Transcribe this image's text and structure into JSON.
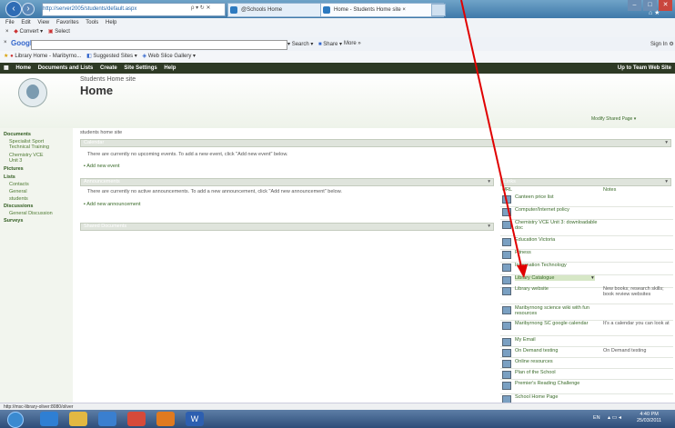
{
  "browser": {
    "address": "http://server2005/students/default.aspx",
    "tabs": [
      "@Schools Home",
      "Home - Students Home site"
    ],
    "menu": [
      "File",
      "Edit",
      "View",
      "Favorites",
      "Tools",
      "Help"
    ],
    "convert_label": "Convert",
    "select_label": "Select",
    "google_label": "Google",
    "google_search": "Search",
    "share_label": "Share",
    "more_label": "More »",
    "signin": "Sign In",
    "fav": [
      "Library Home - Maribyrno...",
      "Suggested Sites",
      "Web Slice Gallery"
    ],
    "status_url": "http://msc-library-oliver:8080/oliver"
  },
  "sharepoint": {
    "topnav": [
      "Home",
      "Documents and Lists",
      "Create",
      "Site Settings",
      "Help"
    ],
    "up_to": "Up to Team Web Site",
    "site_name": "Students Home site",
    "page_title": "Home",
    "modify": "Modify Shared Page ▾",
    "description": "students home site",
    "left_nav": [
      {
        "label": "Documents",
        "head": true
      },
      {
        "label": "Specialist Sport",
        "head": false
      },
      {
        "label": "Technical Training",
        "head": false
      },
      {
        "label": "Chemistry VCE",
        "head": false
      },
      {
        "label": "Unit 3",
        "head": false
      },
      {
        "label": "Pictures",
        "head": true
      },
      {
        "label": "Lists",
        "head": true
      },
      {
        "label": "Contacts",
        "head": false
      },
      {
        "label": "General",
        "head": false
      },
      {
        "label": "students",
        "head": false
      },
      {
        "label": "Discussions",
        "head": true
      },
      {
        "label": "General Discussion",
        "head": false
      },
      {
        "label": "Surveys",
        "head": true
      }
    ],
    "events": {
      "title": "Calendar",
      "text": "There are currently no upcoming events. To add a new event, click \"Add new event\" below.",
      "add": "Add new event"
    },
    "announcements": {
      "title": "Announcements",
      "text": "There are currently no active announcements. To add a new announcement, click \"Add new announcement\" below.",
      "add": "Add new announcement"
    },
    "shared_docs_title": "Shared Documents",
    "links": {
      "title": "Links",
      "col_url": "URL",
      "col_notes": "Notes",
      "rows": [
        {
          "url": "Canteen price list",
          "notes": ""
        },
        {
          "url": "Computer/Internet policy",
          "notes": ""
        },
        {
          "url": "Chemistry VCE Unit 3: downloadable doc",
          "notes": ""
        },
        {
          "url": "Education Victoria",
          "notes": ""
        },
        {
          "url": "Fitness",
          "notes": ""
        },
        {
          "url": "Information Technology",
          "notes": ""
        },
        {
          "url": "Library Catalogue",
          "notes": ""
        },
        {
          "url": "Library website",
          "notes": "New books; research skills; book review websites"
        },
        {
          "url": "Maribyrnong science wiki with fun resources",
          "notes": ""
        },
        {
          "url": "Maribyrnong SC google calendar",
          "notes": "It's a calendar you can look at"
        },
        {
          "url": "My Email",
          "notes": ""
        },
        {
          "url": "On Demand testing",
          "notes": "On Demand testing"
        },
        {
          "url": "Online resources",
          "notes": ""
        },
        {
          "url": "Plan of the School",
          "notes": ""
        },
        {
          "url": "Premier's Reading Challenge",
          "notes": ""
        },
        {
          "url": "School Home Page",
          "notes": ""
        }
      ]
    }
  },
  "taskbar": {
    "time": "4:40 PM",
    "date": "25/03/2011",
    "lang": "EN"
  },
  "colors": {
    "accent": "#3a6b2a",
    "topbar": "#2e3a25",
    "arrow": "#e00000"
  }
}
